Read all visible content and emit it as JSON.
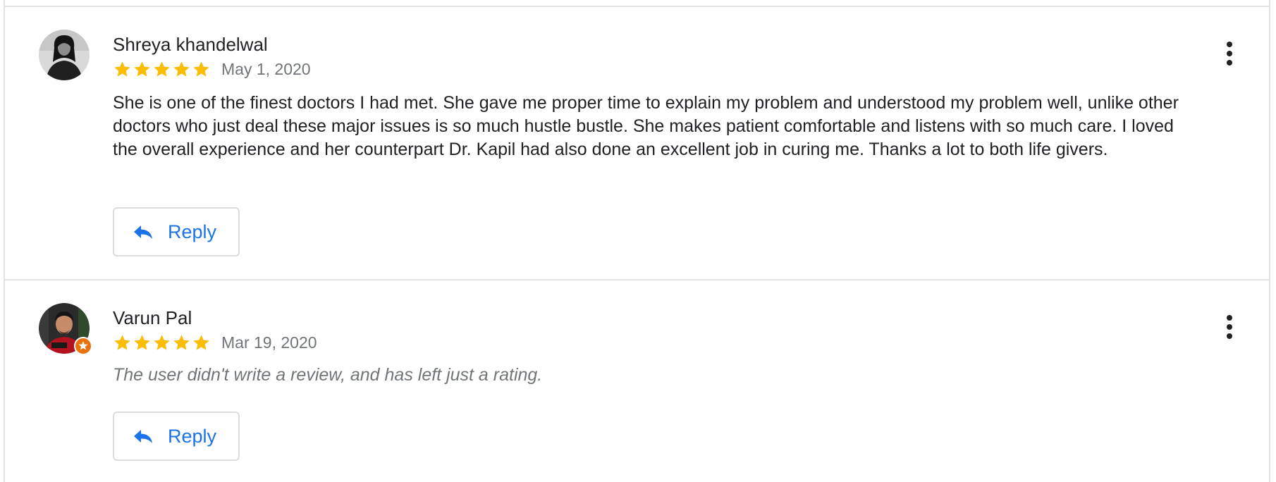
{
  "colors": {
    "star": "#fbbc04",
    "accent": "#1a73e8",
    "divider": "#e3e3e3",
    "text": "#202124",
    "muted": "#70757a"
  },
  "reviews": [
    {
      "reviewer_name": "Shreya khandelwal",
      "stars": 5,
      "date": "May 1, 2020",
      "text": "She is one of the finest doctors I had met. She gave me proper time to explain my problem and understood my problem well, unlike other doctors who just deal these major issues is so much hustle bustle. She makes patient comfortable and listens with so much care. I loved the overall experience and her counterpart Dr. Kapil had also done an excellent job in curing me. Thanks a lot to both life givers.",
      "reply_label": "Reply",
      "icons": {
        "avatar": "user-avatar",
        "more": "more-vert-icon",
        "reply": "reply-arrow-icon",
        "star": "star-icon"
      }
    },
    {
      "reviewer_name": "Varun Pal",
      "stars": 5,
      "date": "Mar 19, 2020",
      "note": "The user didn't write a review, and has left just a rating.",
      "reply_label": "Reply",
      "icons": {
        "avatar": "user-avatar",
        "badge": "local-guide-badge-icon",
        "more": "more-vert-icon",
        "reply": "reply-arrow-icon",
        "star": "star-icon"
      }
    }
  ]
}
